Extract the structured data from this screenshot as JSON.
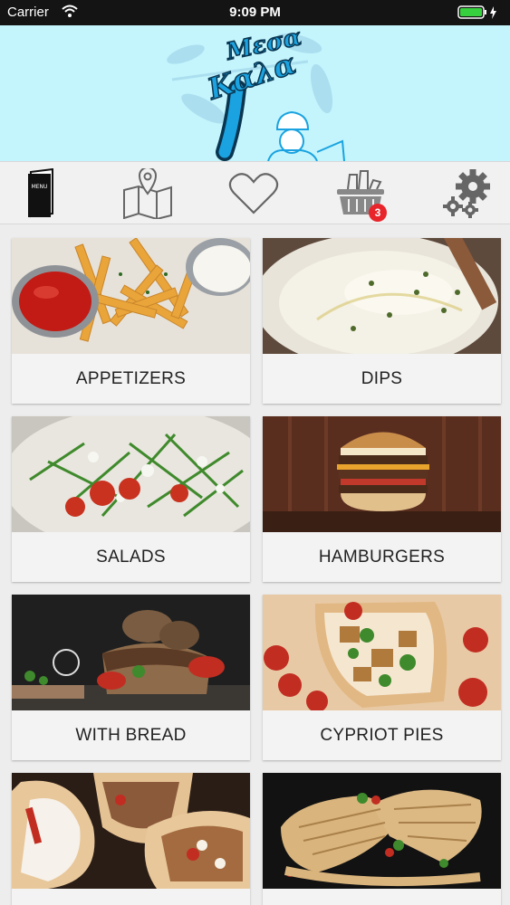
{
  "status_bar": {
    "carrier": "Carrier",
    "time": "9:09 PM"
  },
  "header": {
    "logo_text": "Μεσα Καλα"
  },
  "toolbar": {
    "items": [
      {
        "icon": "menu-book-icon",
        "text": "MENU"
      },
      {
        "icon": "map-icon"
      },
      {
        "icon": "heart-icon"
      },
      {
        "icon": "basket-icon",
        "badge": "3"
      },
      {
        "icon": "gear-icon"
      }
    ]
  },
  "categories": [
    {
      "label": "APPETIZERS"
    },
    {
      "label": "DIPS"
    },
    {
      "label": "SALADS"
    },
    {
      "label": "HAMBURGERS"
    },
    {
      "label": "WITH BREAD"
    },
    {
      "label": "CYPRIOT PIES"
    },
    {
      "label": ""
    },
    {
      "label": ""
    }
  ],
  "colors": {
    "banner": "#c4f5fd",
    "badge": "#e8252b",
    "logo": "#1aa3e0"
  }
}
